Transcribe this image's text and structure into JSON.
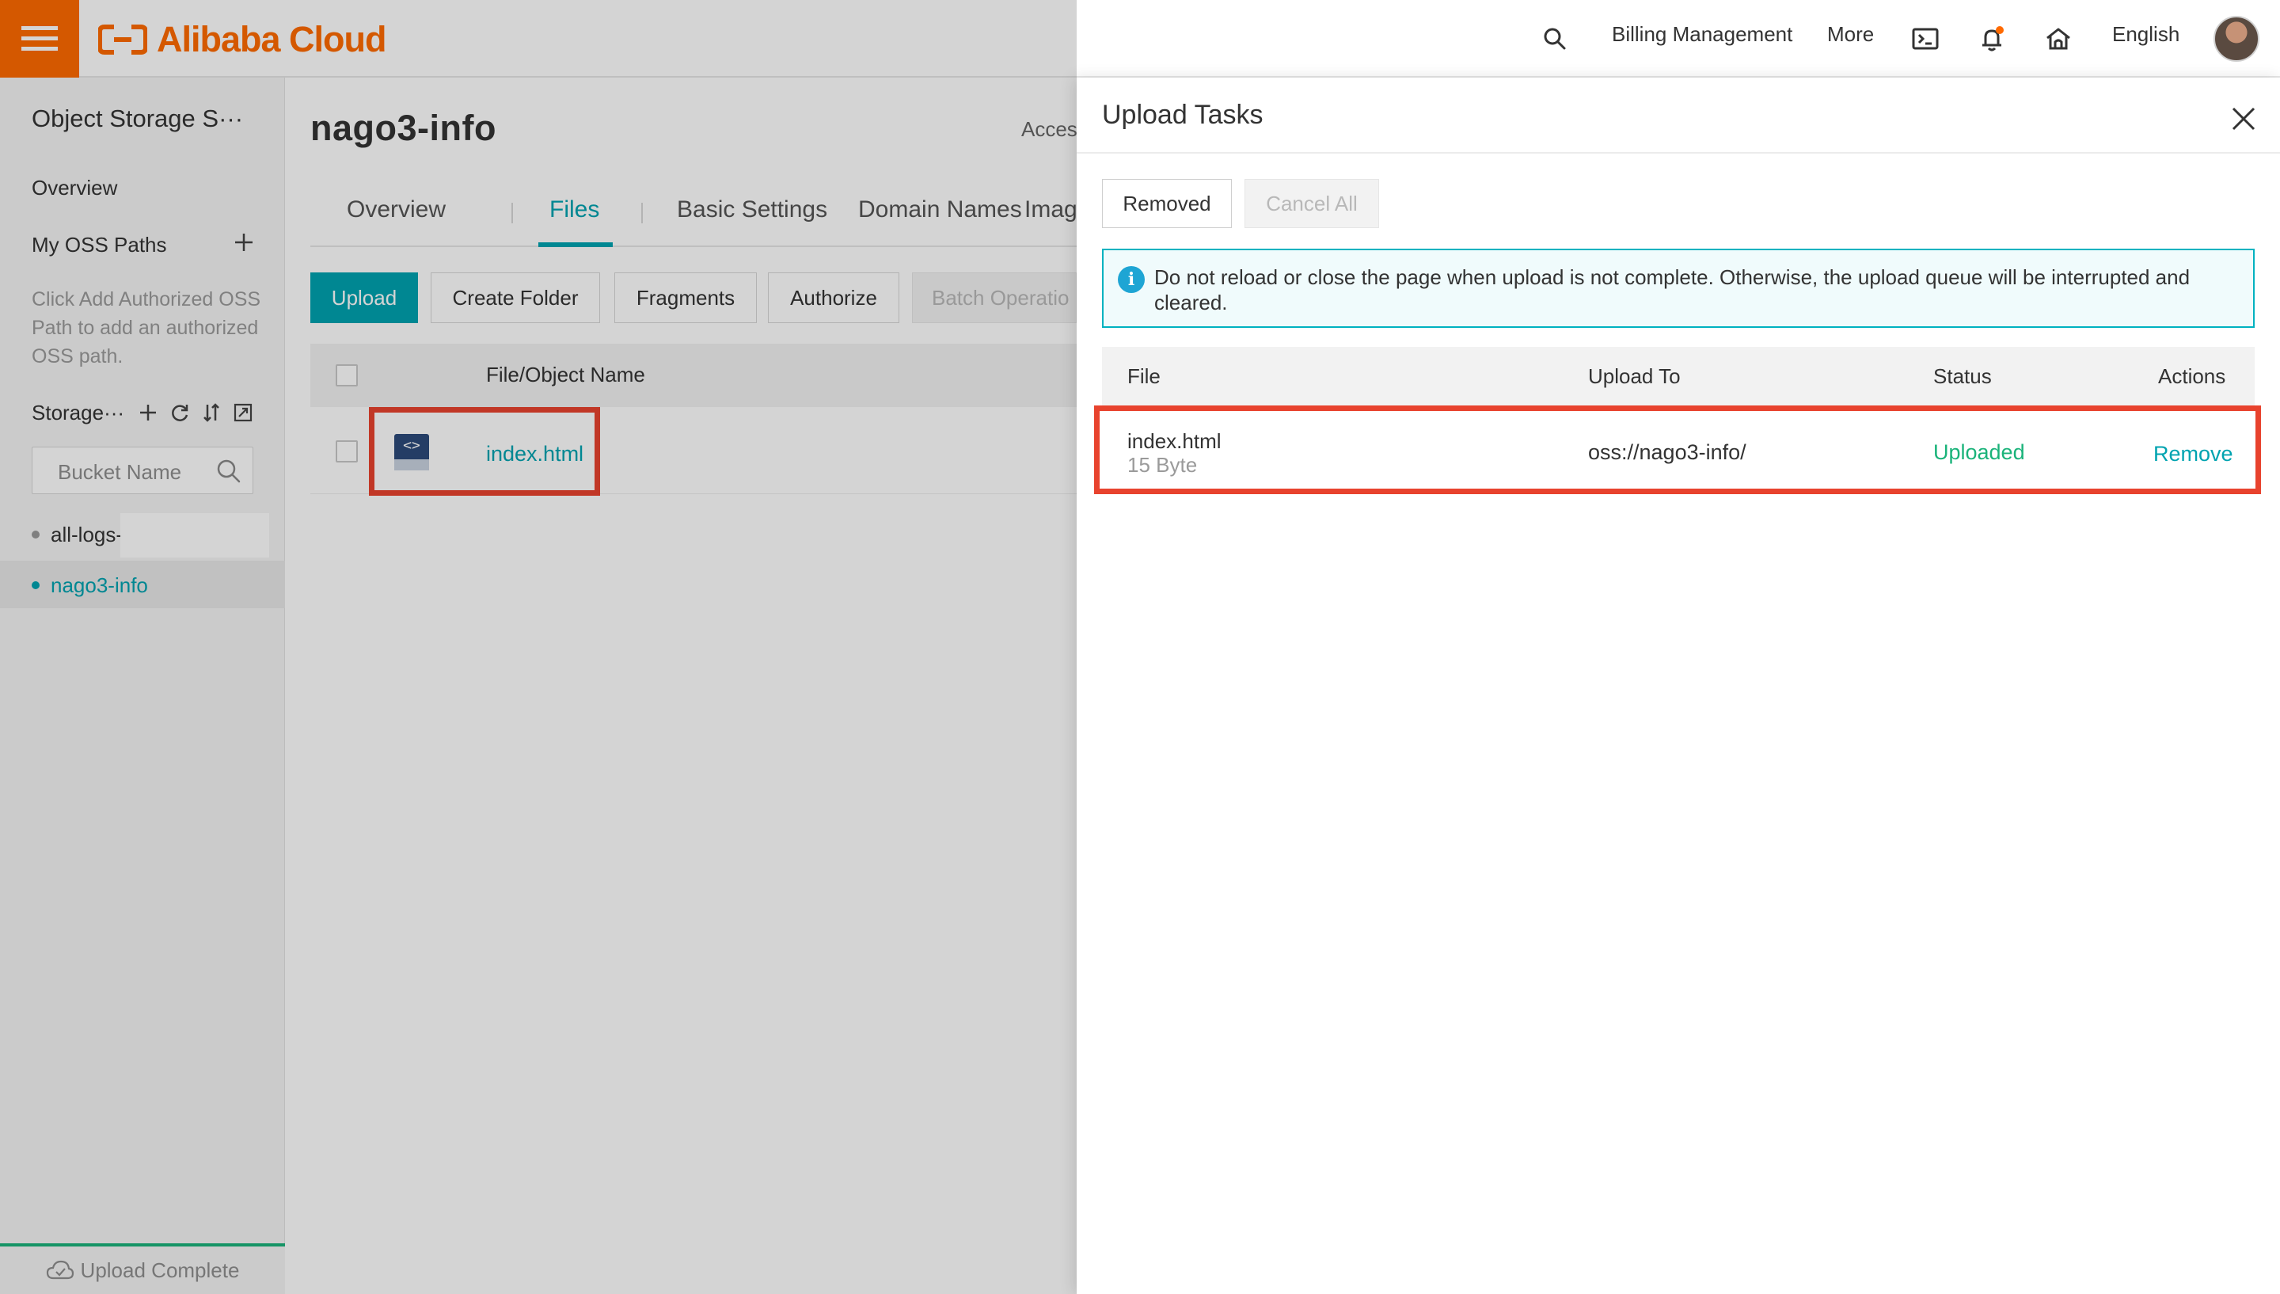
{
  "topbar": {
    "logo_text": "Alibaba Cloud",
    "billing": "Billing Management",
    "more": "More",
    "language": "English"
  },
  "sidebar": {
    "title": "Object Storage S···",
    "overview": "Overview",
    "oss_paths": "My OSS Paths",
    "hint": "Click Add Authorized OSS Path to add an authorized OSS path.",
    "storage": "Storage···",
    "search_placeholder": "Bucket Name",
    "buckets": [
      {
        "name": "all-logs-"
      },
      {
        "name": "nago3-info"
      }
    ],
    "upload_status": "Upload Complete"
  },
  "main": {
    "bucket_title": "nago3-info",
    "access": "Acces",
    "tabs": [
      "Overview",
      "Files",
      "Basic Settings",
      "Domain Names",
      "Imag"
    ],
    "active_tab": "Files",
    "buttons": {
      "upload": "Upload",
      "create_folder": "Create Folder",
      "fragments": "Fragments",
      "authorize": "Authorize",
      "batch": "Batch Operatio"
    },
    "table": {
      "col_name": "File/Object Name",
      "rows": [
        {
          "name": "index.html"
        }
      ]
    }
  },
  "panel": {
    "title": "Upload Tasks",
    "removed_btn": "Removed",
    "cancel_all_btn": "Cancel All",
    "notice": "Do not reload or close the page when upload is not complete. Otherwise, the upload queue will be interrupted and cleared.",
    "columns": {
      "file": "File",
      "upload_to": "Upload To",
      "status": "Status",
      "actions": "Actions"
    },
    "rows": [
      {
        "file": "index.html",
        "size": "15 Byte",
        "dest": "oss://nago3-info/",
        "status": "Uploaded",
        "action": "Remove"
      }
    ]
  },
  "colors": {
    "brand": "#ff6a00",
    "accent": "#00a3b0",
    "success": "#1ab37a",
    "highlight": "#e8432e"
  }
}
